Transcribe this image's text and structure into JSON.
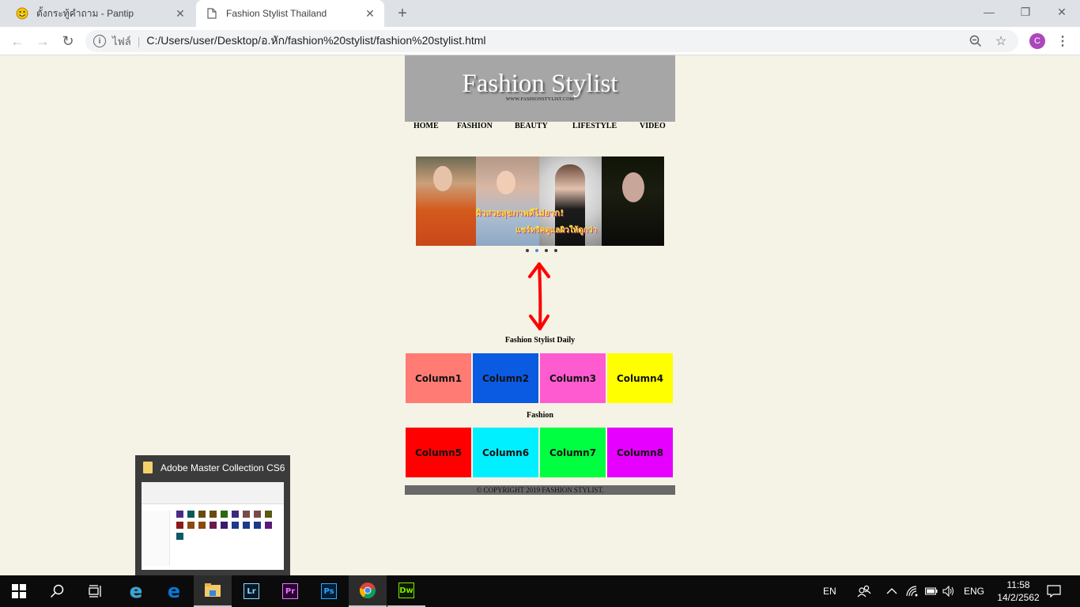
{
  "browser": {
    "tabs": [
      {
        "title": "ตั้งกระทู้คำถาม - Pantip",
        "favicon": "pantip-smiley-icon",
        "active": false
      },
      {
        "title": "Fashion Stylist Thailand",
        "favicon": "document-icon",
        "active": true
      }
    ],
    "new_tab_label": "+",
    "window_controls": {
      "minimize": "—",
      "restore": "❐",
      "close": "✕"
    },
    "nav": {
      "back": "←",
      "forward": "→",
      "reload": "↻"
    },
    "omnibox": {
      "scheme_label": "ไฟล์",
      "url": "C:/Users/user/Desktop/อ.หัก/fashion%20stylist/fashion%20stylist.html"
    },
    "profile_initial": "C",
    "profile_color": "#ab47bc"
  },
  "site": {
    "title": "Fashion Stylist",
    "url_text": "WWW.FASHIONSTYLIST.COM",
    "nav": [
      "HOME",
      "FASHION",
      "BEAUTY",
      "LIFESTYLE",
      "VIDEO"
    ],
    "banner": {
      "line1": "ผิวสวยสุขภาพดีไม่ยาก!",
      "line2": "แชร์ทริคดูแลผิวให้ดูกว่า",
      "slides": 4,
      "active_slide": 2
    },
    "section1": {
      "title": "Fashion Stylist Daily",
      "columns": [
        {
          "label": "Column1",
          "color": "#ff7b73"
        },
        {
          "label": "Column2",
          "color": "#0b5ae2"
        },
        {
          "label": "Column3",
          "color": "#ff5bd0"
        },
        {
          "label": "Column4",
          "color": "#ffff00"
        }
      ]
    },
    "section2": {
      "title": "Fashion",
      "columns": [
        {
          "label": "Column5",
          "color": "#ff0000"
        },
        {
          "label": "Column6",
          "color": "#00f0ff"
        },
        {
          "label": "Column7",
          "color": "#00ff40"
        },
        {
          "label": "Column8",
          "color": "#e600ff"
        }
      ]
    },
    "footer": "© COPYRIGHT 2019 FASHION STYLIST."
  },
  "thumbnail_popup": {
    "title": "Adobe Master Collection CS6"
  },
  "taskbar": {
    "apps": [
      {
        "name": "internet-explorer",
        "label": "e"
      },
      {
        "name": "edge",
        "label": "e"
      },
      {
        "name": "file-explorer",
        "label": ""
      },
      {
        "name": "lightroom",
        "label": "Lr",
        "color": "#9fd4f3"
      },
      {
        "name": "premiere",
        "label": "Pr",
        "color": "#e77bff"
      },
      {
        "name": "photoshop",
        "label": "Ps",
        "color": "#31a8ff"
      },
      {
        "name": "chrome",
        "label": ""
      },
      {
        "name": "dreamweaver",
        "label": "Dw",
        "color": "#7ee600"
      }
    ],
    "lang": "EN",
    "ime": "ENG",
    "time": "11:58",
    "date": "14/2/2562"
  }
}
